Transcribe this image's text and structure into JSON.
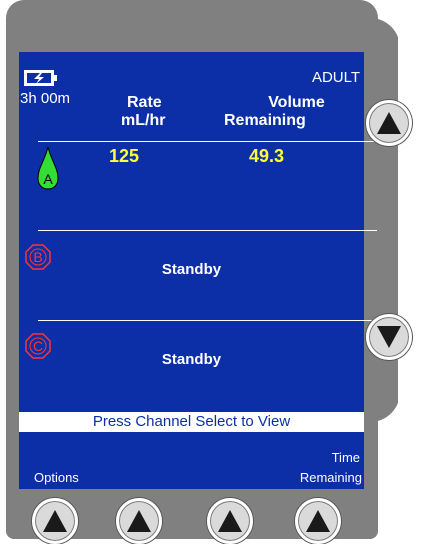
{
  "battery": {
    "time": "3h 00m"
  },
  "patient_profile": "ADULT",
  "headers": {
    "rate_line1": "Rate",
    "rate_line2": "mL/hr",
    "volume_line1": "Volume",
    "volume_line2": "Remaining"
  },
  "channels": [
    {
      "label": "A",
      "rate": "125",
      "volume": "49.3",
      "status": ""
    },
    {
      "label": "B",
      "rate": "",
      "volume": "",
      "status": "Standby"
    },
    {
      "label": "C",
      "rate": "",
      "volume": "",
      "status": "Standby"
    }
  ],
  "prompt": "Press Channel Select to View",
  "softkeys": {
    "options": "Options",
    "time_remaining_line1": "Time",
    "time_remaining_line2": "Remaining"
  },
  "colors": {
    "screen_bg": "#0c2fa8",
    "values": "#ffff33",
    "channel_a": "#33dd33",
    "channel_idle": "#ff3333",
    "bezel": "#808080"
  }
}
